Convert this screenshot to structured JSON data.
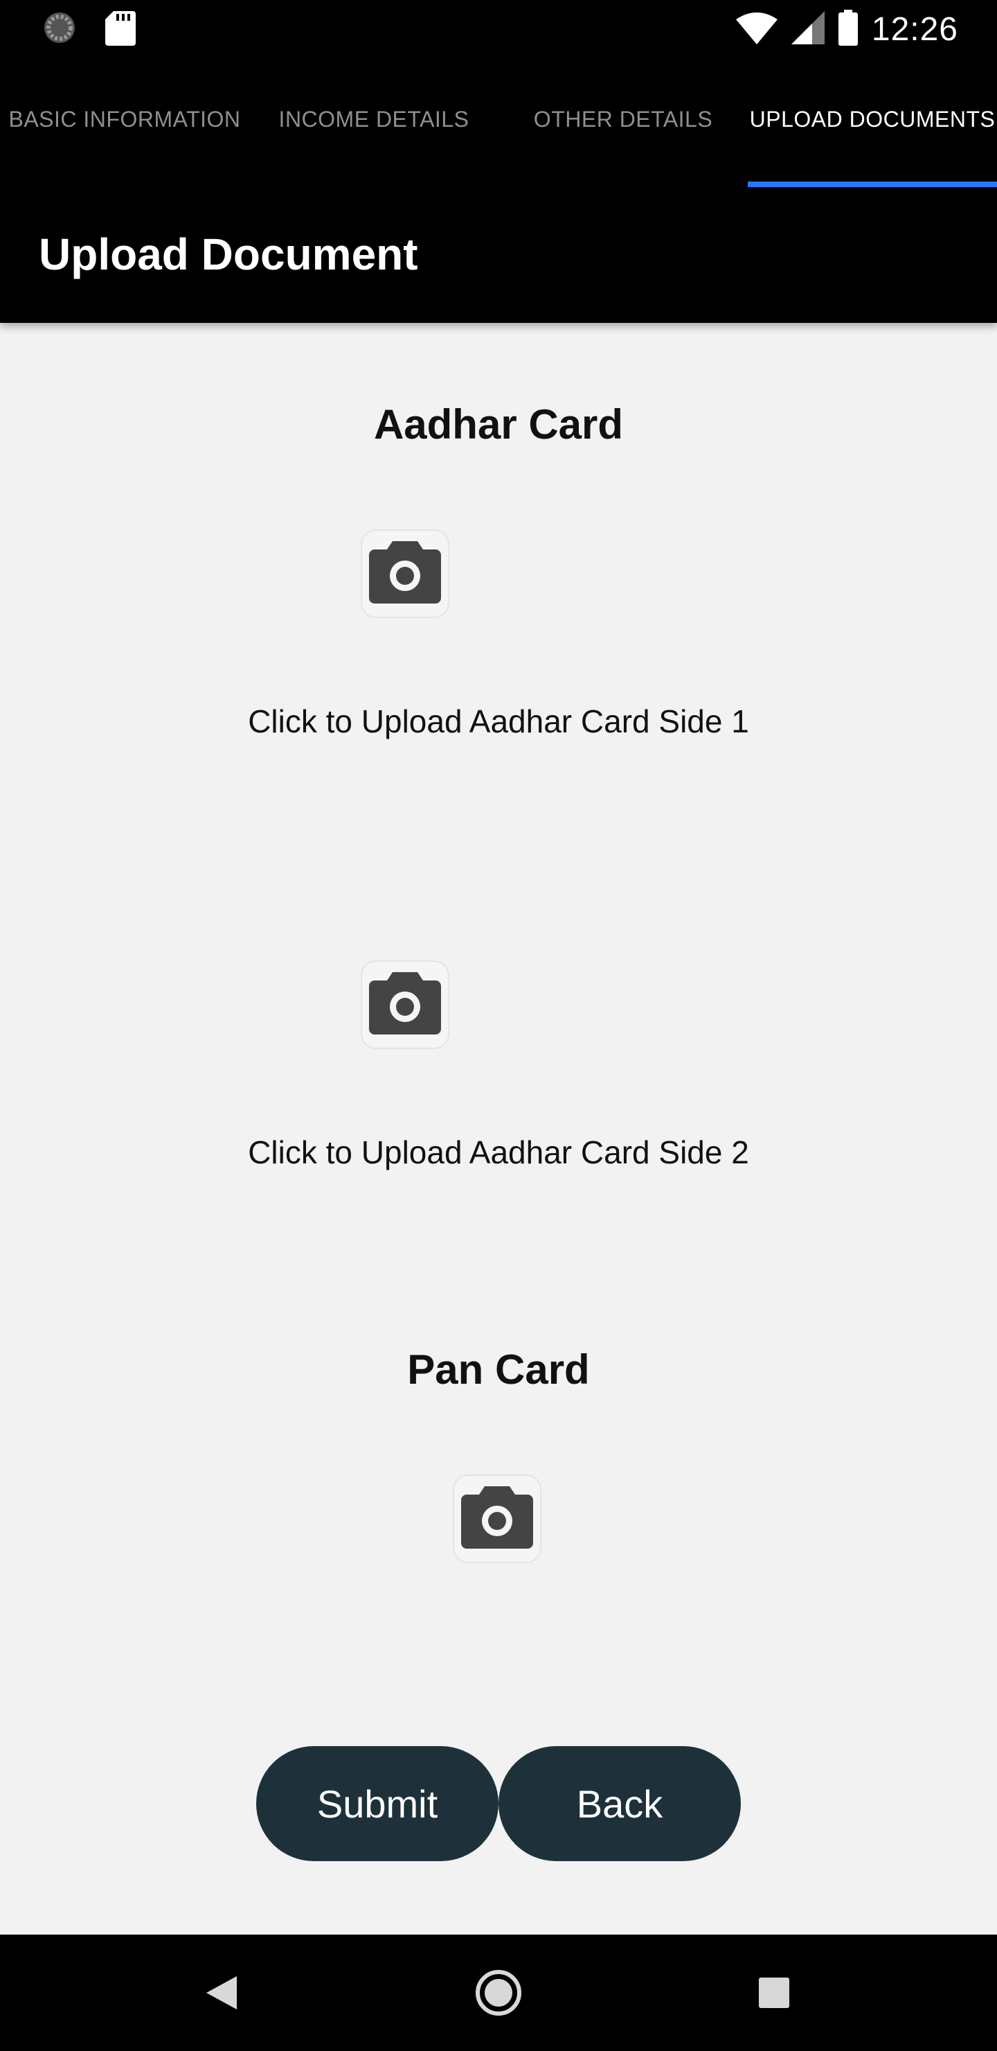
{
  "status_bar": {
    "time": "12:26",
    "left_icons": [
      "loading-icon",
      "sd-card-icon"
    ],
    "right_icons": [
      "wifi-icon",
      "signal-icon",
      "battery-icon"
    ]
  },
  "tabs": [
    {
      "label": "BASIC INFORMATION",
      "active": false
    },
    {
      "label": "INCOME DETAILS",
      "active": false
    },
    {
      "label": "OTHER DETAILS",
      "active": false
    },
    {
      "label": "UPLOAD DOCUMENTS",
      "active": true
    }
  ],
  "colors": {
    "accent": "#2979ff",
    "button_bg": "#1e313b",
    "background": "#f2f2f2",
    "toolbar": "#000000"
  },
  "appbar": {
    "title": "Upload Document"
  },
  "aadhar": {
    "title": "Aadhar Card",
    "side1_caption": "Click to Upload Aadhar Card Side 1",
    "side2_caption": "Click to Upload Aadhar Card Side 2"
  },
  "pan": {
    "title": "Pan Card"
  },
  "actions": {
    "submit_label": "Submit",
    "back_label": "Back"
  },
  "nav_bar": {
    "icons": [
      "back-triangle-icon",
      "home-circle-icon",
      "recents-square-icon"
    ]
  }
}
